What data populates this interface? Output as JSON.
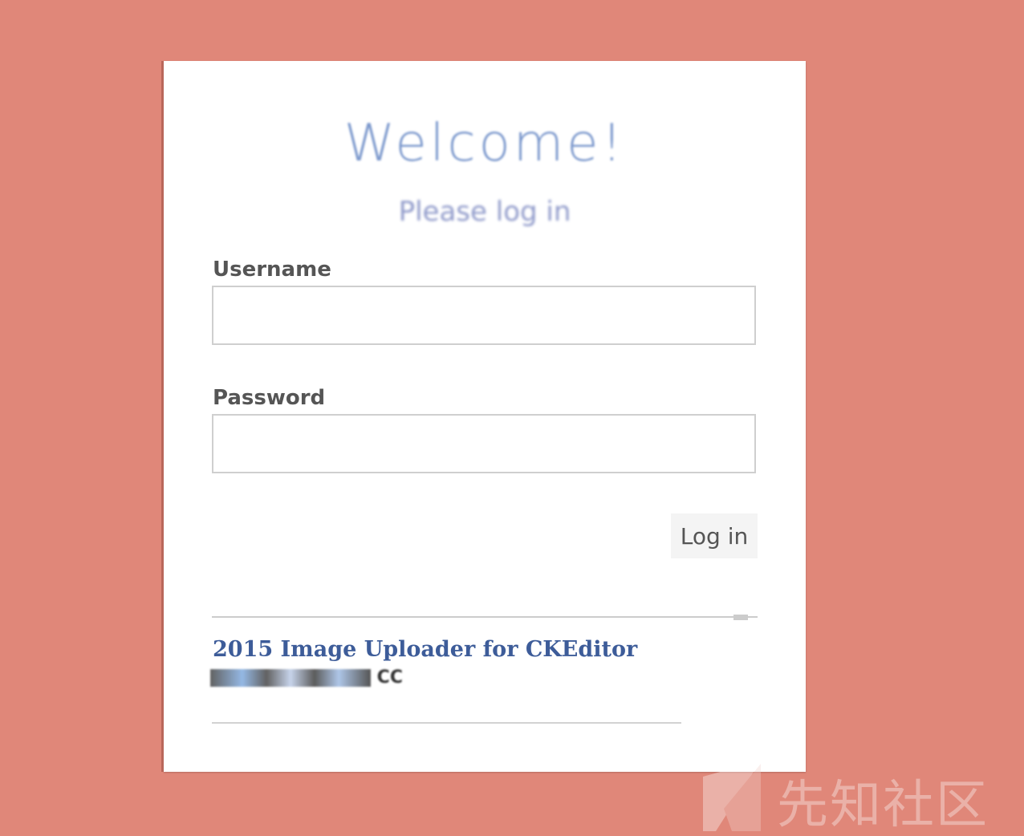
{
  "welcome": {
    "title": "Welcome!",
    "subtitle": "Please log in"
  },
  "form": {
    "username_label": "Username",
    "username_value": "",
    "password_label": "Password",
    "password_value": "",
    "login_label": "Log in"
  },
  "footer": {
    "title": "2015 Image Uploader for CKEditor",
    "author_suffix": "CC"
  },
  "watermark": {
    "text": "先知社区"
  },
  "colors": {
    "background": "#e08779",
    "link": "#3d5c99"
  }
}
